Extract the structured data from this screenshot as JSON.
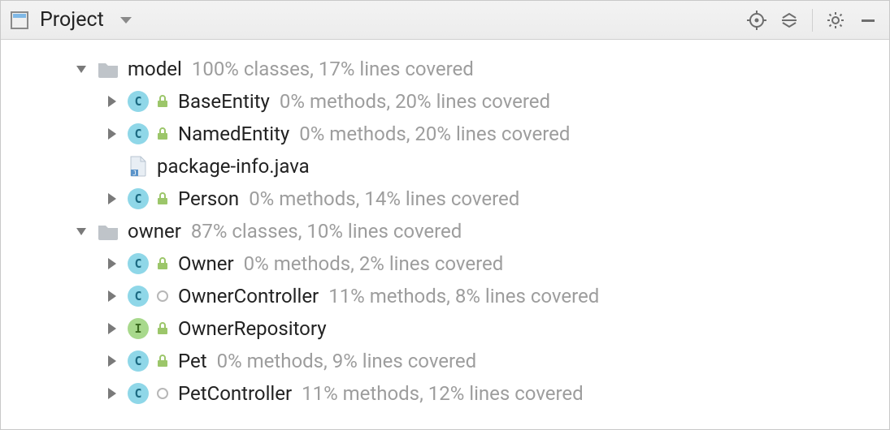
{
  "titlebar": {
    "title": "Project"
  },
  "tree": {
    "folders": [
      {
        "name": "model",
        "coverage": "100% classes, 17% lines covered",
        "expanded": true,
        "children": [
          {
            "kind": "class",
            "name": "BaseEntity",
            "modifier": "lock",
            "coverage": "0% methods, 20% lines covered"
          },
          {
            "kind": "class",
            "name": "NamedEntity",
            "modifier": "lock",
            "coverage": "0% methods, 20% lines covered"
          },
          {
            "kind": "file",
            "name": "package-info.java"
          },
          {
            "kind": "class",
            "name": "Person",
            "modifier": "lock",
            "coverage": "0% methods, 14% lines covered"
          }
        ]
      },
      {
        "name": "owner",
        "coverage": "87% classes, 10% lines covered",
        "expanded": true,
        "children": [
          {
            "kind": "class",
            "name": "Owner",
            "modifier": "lock",
            "coverage": "0% methods, 2% lines covered"
          },
          {
            "kind": "class",
            "name": "OwnerController",
            "modifier": "open",
            "coverage": "11% methods, 8% lines covered"
          },
          {
            "kind": "interface",
            "name": "OwnerRepository",
            "modifier": "lock",
            "coverage": ""
          },
          {
            "kind": "class",
            "name": "Pet",
            "modifier": "lock",
            "coverage": "0% methods, 9% lines covered"
          },
          {
            "kind": "class",
            "name": "PetController",
            "modifier": "open",
            "coverage": "11% methods, 12% lines covered"
          }
        ]
      }
    ]
  },
  "icons": {
    "class_letter": "C",
    "interface_letter": "I"
  }
}
